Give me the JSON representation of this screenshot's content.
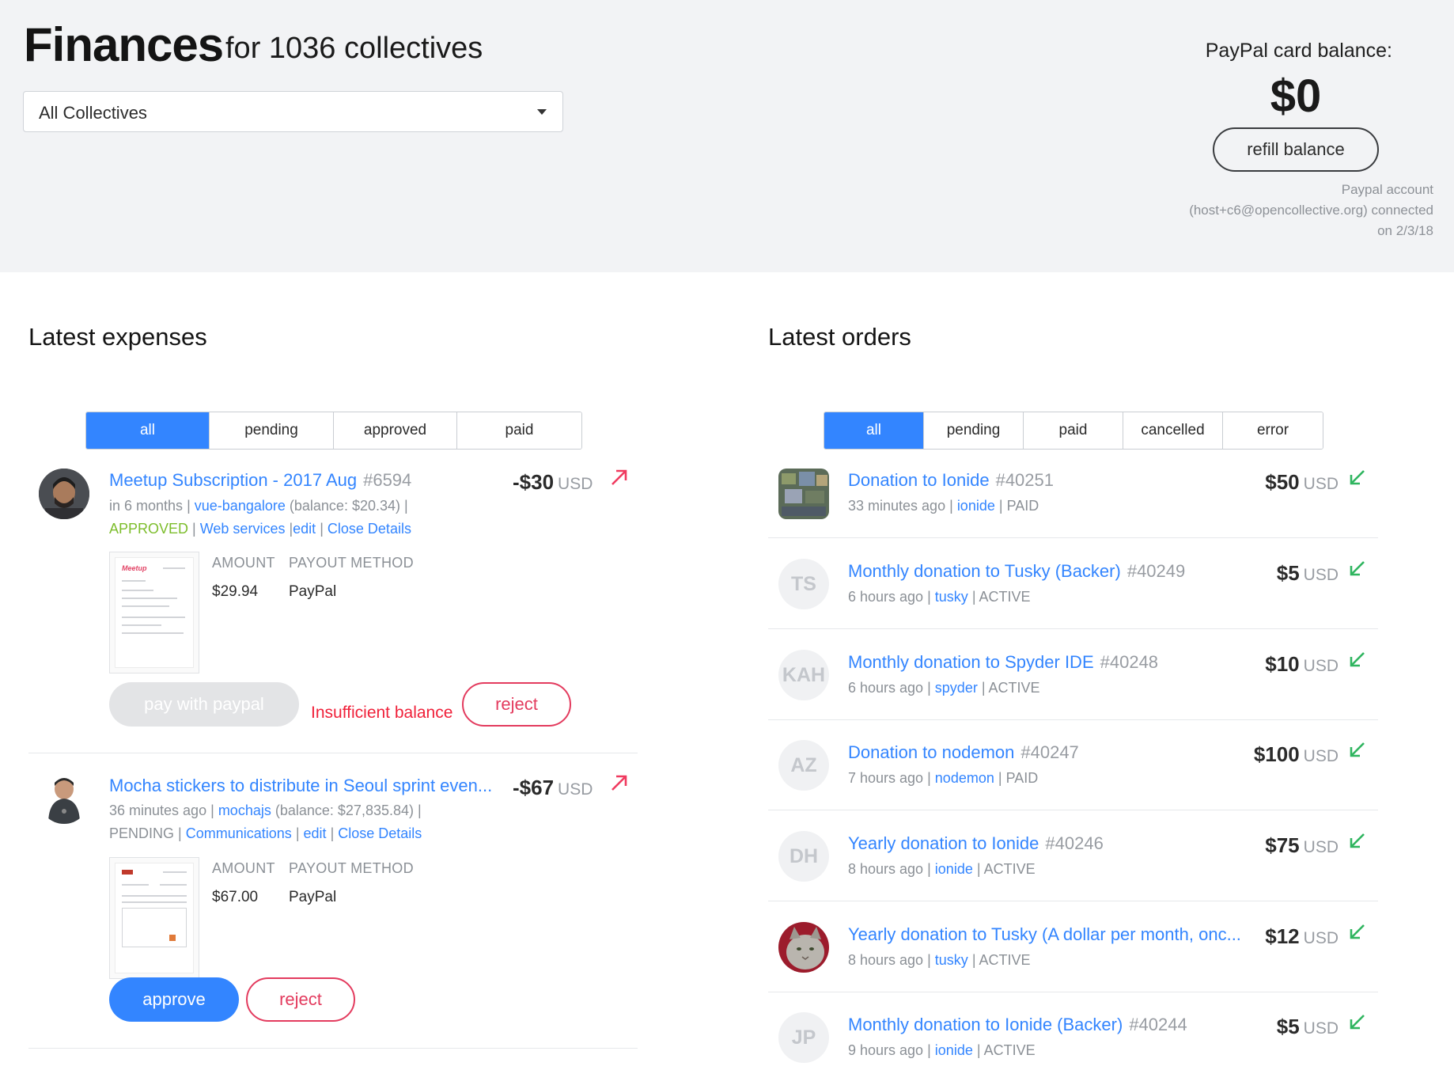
{
  "header": {
    "title": "Finances",
    "subtitle": "for 1036 collectives",
    "collective_select": "All Collectives",
    "paypal_label": "PayPal card balance:",
    "paypal_balance": "$0",
    "refill_label": "refill balance",
    "paypal_note_1": "Paypal account",
    "paypal_note_2": "(host+c6@opencollective.org) connected",
    "paypal_note_3": "on 2/3/18"
  },
  "expenses": {
    "title": "Latest expenses",
    "tabs": [
      "all",
      "pending",
      "approved",
      "paid"
    ],
    "items": [
      {
        "title": "Meetup Subscription - 2017 Aug",
        "number": "#6594",
        "amount": "-$30",
        "currency": "USD",
        "time": "in 6 months",
        "collective": "vue-bangalore",
        "balance": "(balance: $20.34)",
        "status": "APPROVED",
        "category": "Web services",
        "edit": "edit",
        "close": "Close Details",
        "amount_header": "AMOUNT",
        "payout_header": "PAYOUT METHOD",
        "detail_amount": "$29.94",
        "detail_payout": "PayPal",
        "pay_label": "pay with paypal",
        "error": "Insufficient balance",
        "reject_label": "reject"
      },
      {
        "title": "Mocha stickers to distribute in Seoul sprint even...",
        "amount": "-$67",
        "currency": "USD",
        "time": "36 minutes ago",
        "collective": "mochajs",
        "balance": "(balance: $27,835.84)",
        "status": "PENDING",
        "category": "Communications",
        "edit": "edit",
        "close": "Close Details",
        "amount_header": "AMOUNT",
        "payout_header": "PAYOUT METHOD",
        "detail_amount": "$67.00",
        "detail_payout": "PayPal",
        "approve_label": "approve",
        "reject_label": "reject"
      }
    ]
  },
  "orders": {
    "title": "Latest orders",
    "tabs": [
      "all",
      "pending",
      "paid",
      "cancelled",
      "error"
    ],
    "items": [
      {
        "title": "Donation to Ionide",
        "number": "#40251",
        "time": "33 minutes ago",
        "collective": "ionide",
        "status": "PAID",
        "amount": "$50",
        "currency": "USD",
        "initials": ""
      },
      {
        "title": "Monthly donation to Tusky (Backer)",
        "number": "#40249",
        "time": "6 hours ago",
        "collective": "tusky",
        "status": "ACTIVE",
        "amount": "$5",
        "currency": "USD",
        "initials": "TS"
      },
      {
        "title": "Monthly donation to Spyder IDE",
        "number": "#40248",
        "time": "6 hours ago",
        "collective": "spyder",
        "status": "ACTIVE",
        "amount": "$10",
        "currency": "USD",
        "initials": "KAH"
      },
      {
        "title": "Donation to nodemon",
        "number": "#40247",
        "time": "7 hours ago",
        "collective": "nodemon",
        "status": "PAID",
        "amount": "$100",
        "currency": "USD",
        "initials": "AZ"
      },
      {
        "title": "Yearly donation to Ionide",
        "number": "#40246",
        "time": "8 hours ago",
        "collective": "ionide",
        "status": "ACTIVE",
        "amount": "$75",
        "currency": "USD",
        "initials": "DH"
      },
      {
        "title": "Yearly donation to Tusky (A dollar per month, onc...",
        "number": "",
        "time": "8 hours ago",
        "collective": "tusky",
        "status": "ACTIVE",
        "amount": "$12",
        "currency": "USD",
        "initials": ""
      },
      {
        "title": "Monthly donation to Ionide (Backer)",
        "number": "#40244",
        "time": "9 hours ago",
        "collective": "ionide",
        "status": "ACTIVE",
        "amount": "$5",
        "currency": "USD",
        "initials": "JP"
      }
    ]
  },
  "separator": "|",
  "colors": {
    "accent": "#3385ff",
    "reject": "#e33b5e",
    "error": "#f0213a",
    "approved": "#7dbd2c",
    "incoming_arrow": "#2fb55f",
    "outgoing_arrow": "#f03a5f"
  },
  "icons": {
    "outgoing": "arrow-up-right-icon",
    "incoming": "arrow-down-left-icon",
    "dropdown": "caret-down-icon"
  }
}
